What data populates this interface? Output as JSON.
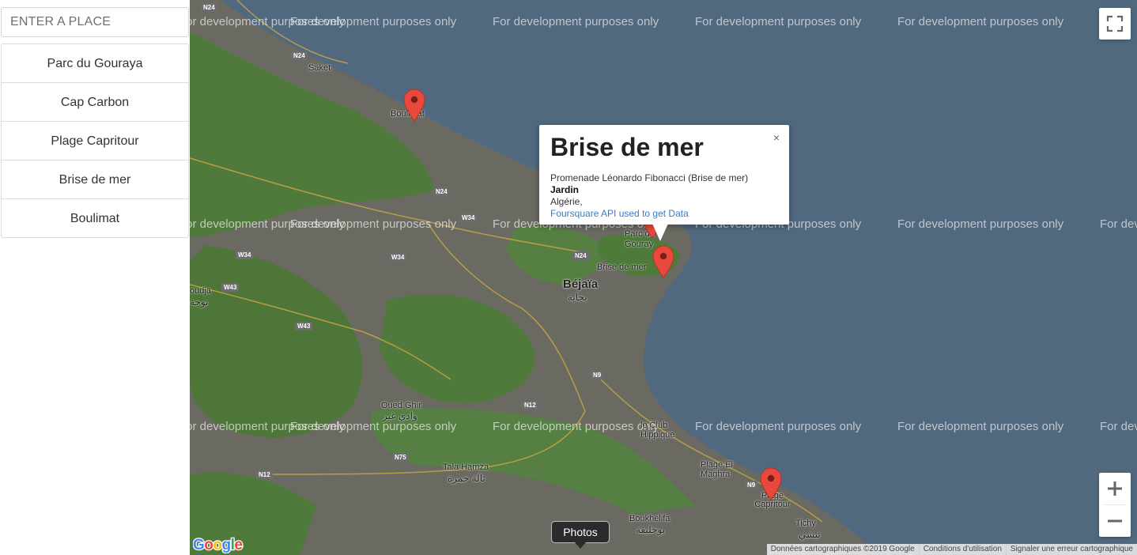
{
  "search": {
    "placeholder": "ENTER A PLACE"
  },
  "places": [
    "Parc du Gouraya",
    "Cap Carbon",
    "Plage Capritour",
    "Brise de mer",
    "Boulimat"
  ],
  "map": {
    "watermark": "For development purposes only",
    "labels": {
      "saket": "Saket",
      "boulimat": "Boulimat",
      "bejaia": "Béjaïa",
      "bejaia_ar": "بجاية",
      "parc_gouraya": "Parc d.. Gouray",
      "brise_de_mer": "Brise de mer",
      "oued_ghir": "Oued Ghir",
      "oued_ghir_ar": "وادي غير",
      "toudja": "oudja",
      "toudja_ar": "توجة",
      "club_hippique": "le Club Hippique",
      "plage_el_maghra": "Plage El Maghra",
      "plage_capritour": "Plage Capritour",
      "tala_hamza": "Tala Hamza",
      "tala_hamza_ar": "تالة حمزة",
      "boukhelifa": "Boukhelifa",
      "boukhelifa_ar": "بوخليفة",
      "tichy": "Tichy",
      "tichy_ar": "تيشي"
    },
    "roads": [
      "N24",
      "N24",
      "N24",
      "W34",
      "W34",
      "W34",
      "W43",
      "W43",
      "N24",
      "N9",
      "N12",
      "N75",
      "N12",
      "N9"
    ],
    "photos_label": "Photos",
    "google_logo": "Google",
    "attribution": [
      "Données cartographiques ©2019 Google",
      "Conditions d'utilisation",
      "Signaler une erreur cartographique"
    ],
    "zoom_in": "+",
    "zoom_out": "−"
  },
  "infowindow": {
    "title": "Brise de mer",
    "address": "Promenade Léonardo Fibonacci (Brise de mer)",
    "category": "Jardin",
    "country": "Algérie,",
    "link": "Foursquare API used to get Data",
    "close": "×"
  },
  "colors": {
    "sea": "#51697f",
    "land": "#6b6a62",
    "vegetation": "#4f7a3c",
    "marker": "#e8493c"
  }
}
